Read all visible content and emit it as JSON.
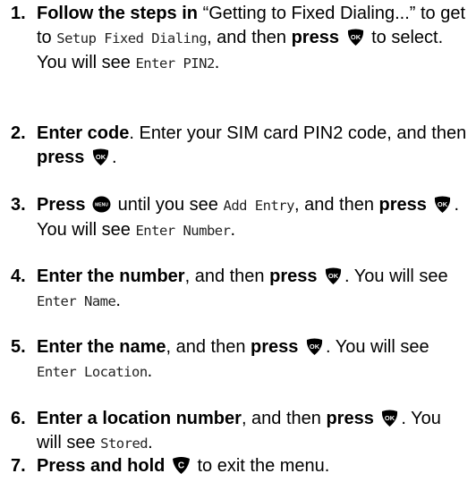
{
  "steps": [
    {
      "number": "1.",
      "bold": "Follow the steps in",
      "t1": " “Getting to Fixed Dialing...” to get to ",
      "lcd1": "Setup Fixed Dialing",
      "t2": ", and then ",
      "bold2": "press",
      "t3": " to select. You will see ",
      "lcd2": "Enter PIN2",
      "t4": "."
    },
    {
      "number": "2.",
      "bold": "Enter code",
      "t1": ". Enter your SIM card PIN2 code, and then ",
      "bold2": "press",
      "t2": "."
    },
    {
      "number": "3.",
      "bold": "Press",
      "t1": " until you see ",
      "lcd1": "Add Entry",
      "t2": ", and then ",
      "bold2": "press",
      "t3": ". You will see ",
      "lcd2": "Enter Number",
      "t4": "."
    },
    {
      "number": "4.",
      "bold": "Enter the number",
      "t1": ", and then ",
      "bold2": "press",
      "t2": ". You will see ",
      "lcd1": "Enter Name",
      "t3": "."
    },
    {
      "number": "5.",
      "bold": "Enter the name",
      "t1": ", and then ",
      "bold2": "press",
      "t2": ". You will see ",
      "lcd1": "Enter Location",
      "t3": "."
    },
    {
      "number": "6.",
      "bold": "Enter a location number",
      "t1": ", and then ",
      "bold2": "press",
      "t2": ". You will see ",
      "lcd1": "Stored",
      "t3": "."
    },
    {
      "number": "7.",
      "bold": "Press and hold",
      "t1": " to exit the menu."
    }
  ],
  "keys": {
    "ok": {
      "name": "ok-key-icon",
      "label": "OK",
      "color": "#000000"
    },
    "menu": {
      "name": "menu-key-icon",
      "label": "MENU",
      "color": "#000000"
    },
    "clear": {
      "name": "clear-key-icon",
      "label": "C",
      "color": "#000000"
    }
  }
}
